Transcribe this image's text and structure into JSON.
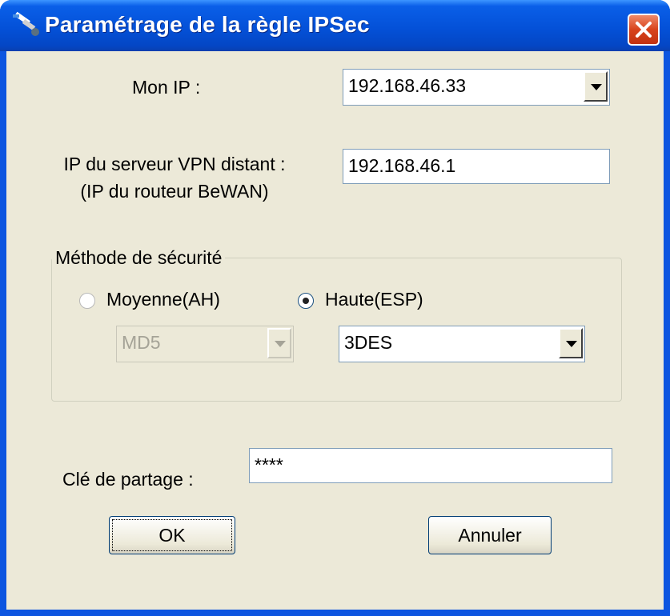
{
  "window": {
    "title": "Paramétrage de la règle IPSec"
  },
  "icons": {
    "title": "tool-icon",
    "close": "close-icon"
  },
  "colors": {
    "titlebar": "#0451d8",
    "client": "#ece9d8",
    "close": "#d8431c"
  },
  "my_ip": {
    "label": "Mon IP :",
    "value": "192.168.46.33"
  },
  "vpn_server": {
    "label_line1": "IP du serveur VPN distant :",
    "label_line2": "(IP du routeur BeWAN)",
    "value": "192.168.46.1"
  },
  "security": {
    "legend": "Méthode de sécurité",
    "medium": {
      "label": "Moyenne(AH)",
      "checked": false,
      "algo": "MD5"
    },
    "high": {
      "label": "Haute(ESP)",
      "checked": true,
      "algo": "3DES"
    }
  },
  "shared_key": {
    "label": "Clé de partage :",
    "value": "****"
  },
  "buttons": {
    "ok": "OK",
    "cancel": "Annuler"
  }
}
